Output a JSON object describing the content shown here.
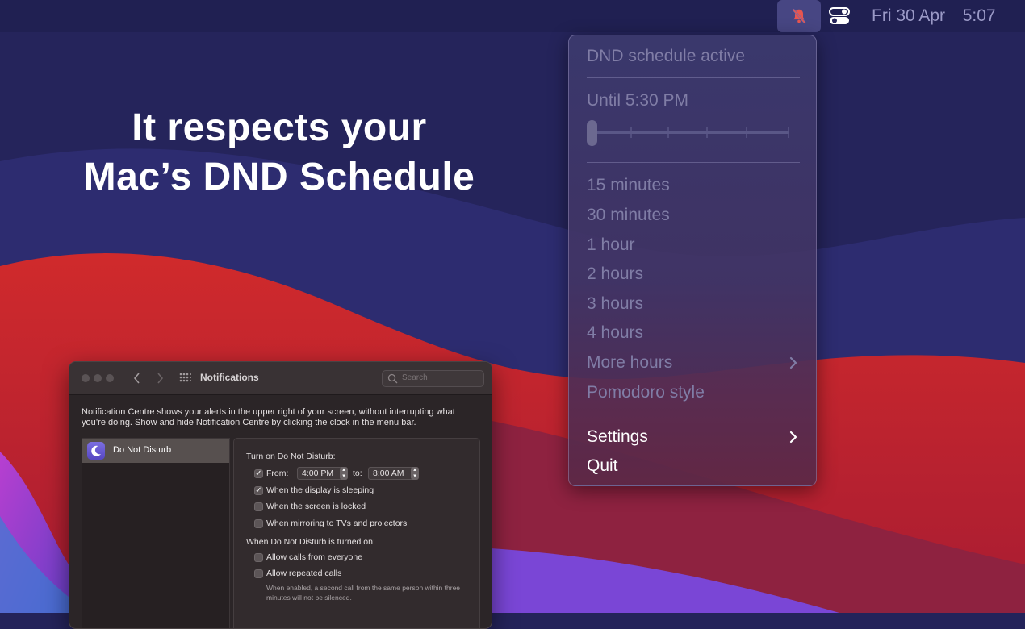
{
  "colors": {
    "wallpaper_base": "#24235a",
    "wallpaper_wave": "#2e2d73",
    "wallpaper_red": "#c4232b",
    "wallpaper_purple": "#9b3bc4",
    "dnd_icon": "#e8554f",
    "menu_enabled": "#ffffff",
    "menu_disabled": "#807da6"
  },
  "menubar": {
    "dnd_icon": "bell-slash-icon",
    "control_center_icon": "toggle-switches-icon",
    "date": "Fri 30 Apr",
    "time": "5:07"
  },
  "headline": {
    "line1": "It respects your",
    "line2": "Mac’s DND Schedule"
  },
  "menu": {
    "status": "DND schedule active",
    "until": "Until 5:30 PM",
    "slider_level": 0,
    "durations": [
      "15 minutes",
      "30 minutes",
      "1 hour",
      "2 hours",
      "3 hours",
      "4 hours"
    ],
    "more_hours": "More hours",
    "pomodoro": "Pomodoro style",
    "settings": "Settings",
    "quit": "Quit"
  },
  "prefs_window": {
    "title": "Notifications",
    "search_placeholder": "Search",
    "description": "Notification Centre shows your alerts in the upper right of your screen, without interrupting what you’re doing. Show and hide Notification Centre by clicking the clock in the menu bar.",
    "sidebar_item": "Do Not Disturb",
    "turn_on_label": "Turn on Do Not Disturb:",
    "from_label": "From:",
    "from_value": "4:00 PM",
    "to_label": "to:",
    "to_value": "8:00 AM",
    "display_sleeping": "When the display is sleeping",
    "screen_locked": "When the screen is locked",
    "mirroring": "When mirroring to TVs and projectors",
    "when_on_label": "When Do Not Disturb is turned on:",
    "allow_calls": "Allow calls from everyone",
    "allow_repeated": "Allow repeated calls",
    "repeated_note": "When enabled, a second call from the same person within three minutes will not be silenced."
  }
}
